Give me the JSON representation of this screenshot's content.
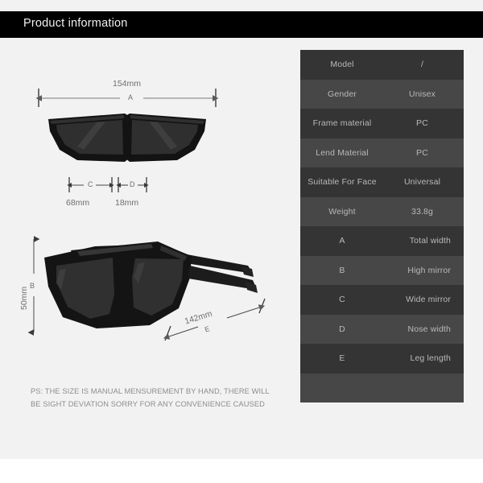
{
  "header": {
    "title": "Product information"
  },
  "spec_table": {
    "rows": [
      {
        "label": "Model",
        "value": "/",
        "style": "dark",
        "kind": "spec"
      },
      {
        "label": "Gender",
        "value": "Unisex",
        "style": "light",
        "kind": "spec"
      },
      {
        "label": "Frame material",
        "value": "PC",
        "style": "dark",
        "kind": "spec"
      },
      {
        "label": "Lend Material",
        "value": "PC",
        "style": "light",
        "kind": "spec"
      },
      {
        "label": "Suitable For Face",
        "value": "Universal",
        "style": "dark",
        "kind": "spec"
      },
      {
        "label": "Weight",
        "value": "33.8g",
        "style": "light",
        "kind": "spec"
      },
      {
        "label": "A",
        "value": "Total width",
        "style": "dark",
        "kind": "legend"
      },
      {
        "label": "B",
        "value": "High mirror",
        "style": "light",
        "kind": "legend"
      },
      {
        "label": "C",
        "value": "Wide mirror",
        "style": "dark",
        "kind": "legend"
      },
      {
        "label": "D",
        "value": "Nose width",
        "style": "light",
        "kind": "legend"
      },
      {
        "label": "E",
        "value": "Leg length",
        "style": "dark",
        "kind": "legend"
      },
      {
        "label": "",
        "value": "",
        "style": "light",
        "kind": "empty"
      }
    ]
  },
  "diagram": {
    "front_view": {
      "width_value": "154mm",
      "width_letter": "A",
      "lens_width_value": "68mm",
      "lens_width_letter": "C",
      "nose_width_value": "18mm",
      "nose_width_letter": "D"
    },
    "angled_view": {
      "height_value": "50mm",
      "height_letter": "B",
      "leg_length_value": "142mm",
      "leg_length_letter": "E"
    }
  },
  "note": {
    "line1": "PS:  THE SIZE IS MANUAL MENSUREMENT BY HAND, THERE WILL",
    "line2": "BE SIGHT DEVIATION SORRY FOR ANY CONVENIENCE CAUSED"
  },
  "colors": {
    "background": "#f2f2f2",
    "header_bar": "#000000",
    "row_dark": "#343434",
    "row_light": "#474747",
    "table_text": "#b9b9b9",
    "dimension_text": "#6f6f6f",
    "frame": "#141414",
    "lens": "#2e2e2e"
  }
}
